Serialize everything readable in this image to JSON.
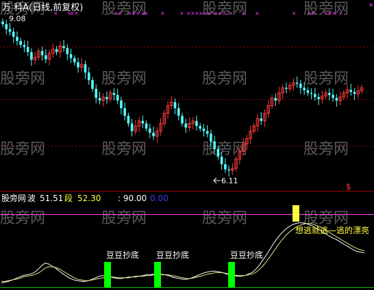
{
  "watermark": "股旁网",
  "upper_panel": {
    "title": "万 科A(日线,前复权)",
    "high_label": "9.08",
    "low_label": "6.11",
    "signal_glyph": "$"
  },
  "lower_panel": {
    "indicator_label": "股旁网",
    "wave_name": "波",
    "wave_value": "51.51",
    "segment_name": "段",
    "segment_value": "52.30",
    "level_value": ": 90.00",
    "base_value": "0.00",
    "buy_label": "豆豆抄底",
    "sell_label": "想逃就逃—逃的漂亮"
  },
  "colors": {
    "background": "#000000",
    "up_candle": "#ff3a3a",
    "down_candle": "#54ffff",
    "grid": "#a00000",
    "magenta": "#ff40ff",
    "yellow": "#ffff40",
    "white": "#ffffff",
    "green": "#00ff00",
    "blue": "#3b3bff",
    "title_color": "#ffffff"
  },
  "chart_data": [
    {
      "type": "candlestick",
      "name": "price",
      "annotations": [
        {
          "text": "9.08",
          "kind": "high"
        },
        {
          "text": "6.11",
          "kind": "low"
        }
      ],
      "ylim": [
        5.9,
        9.2
      ],
      "close": [
        9.05,
        8.95,
        8.9,
        8.8,
        8.72,
        8.64,
        8.6,
        8.5,
        8.35,
        8.4,
        8.52,
        8.44,
        8.36,
        8.48,
        8.56,
        8.5,
        8.62,
        8.58,
        8.46,
        8.38,
        8.3,
        8.2,
        8.26,
        8.1,
        7.95,
        7.78,
        7.6,
        7.55,
        7.62,
        7.58,
        7.7,
        7.66,
        7.55,
        7.4,
        7.25,
        7.1,
        6.95,
        7.05,
        7.15,
        7.1,
        7.0,
        6.92,
        6.85,
        6.95,
        7.1,
        7.3,
        7.45,
        7.52,
        7.4,
        7.25,
        7.1,
        7.02,
        7.1,
        7.15,
        7.05,
        7.0,
        6.95,
        6.9,
        6.75,
        6.6,
        6.45,
        6.3,
        6.2,
        6.18,
        6.22,
        6.4,
        6.55,
        6.7,
        6.8,
        6.95,
        7.05,
        7.2,
        7.15,
        7.3,
        7.45,
        7.6,
        7.55,
        7.7,
        7.8,
        7.78,
        7.85,
        7.9,
        7.88,
        7.8,
        7.75,
        7.7,
        7.68,
        7.62,
        7.58,
        7.64,
        7.7,
        7.66,
        7.6,
        7.55,
        7.62,
        7.7,
        7.76,
        7.72,
        7.68,
        7.74,
        7.8
      ]
    },
    {
      "type": "line",
      "name": "indicator",
      "ylim": [
        0,
        100
      ],
      "reference_levels": [
        90,
        0
      ],
      "series": [
        {
          "color": "white",
          "values": [
            6,
            7,
            8,
            10,
            12,
            14,
            16,
            17,
            18,
            20,
            24,
            29,
            33,
            32,
            29,
            26,
            22,
            18,
            15,
            12,
            10,
            9,
            8,
            8,
            9,
            11,
            13,
            15,
            16,
            15,
            14,
            13,
            12,
            12,
            13,
            14,
            14,
            15,
            15,
            16,
            17,
            17,
            18,
            18,
            18,
            17,
            16,
            14,
            13,
            12,
            11,
            11,
            12,
            14,
            16,
            18,
            20,
            21,
            22,
            22,
            21,
            20,
            18,
            17,
            16,
            15,
            15,
            16,
            18,
            20,
            24,
            30,
            37,
            44,
            52,
            60,
            67,
            73,
            78,
            82,
            85,
            87,
            88,
            88,
            87,
            85,
            83,
            80,
            77,
            74,
            71,
            68,
            66,
            63,
            60,
            57,
            54,
            51,
            49,
            48,
            47
          ]
        },
        {
          "color": "yellow",
          "values": [
            8,
            8,
            9,
            10,
            11,
            12,
            14,
            15,
            16,
            17,
            19,
            22,
            26,
            28,
            28,
            27,
            25,
            22,
            19,
            16,
            13,
            11,
            10,
            9,
            9,
            10,
            11,
            12,
            13,
            14,
            14,
            14,
            13,
            13,
            13,
            13,
            14,
            14,
            15,
            15,
            16,
            16,
            17,
            17,
            17,
            17,
            17,
            16,
            15,
            14,
            13,
            12,
            12,
            13,
            14,
            15,
            17,
            18,
            19,
            20,
            20,
            20,
            19,
            18,
            17,
            16,
            16,
            16,
            17,
            18,
            20,
            24,
            29,
            35,
            42,
            49,
            56,
            63,
            69,
            74,
            78,
            82,
            84,
            86,
            87,
            87,
            86,
            84,
            82,
            79,
            76,
            73,
            70,
            67,
            64,
            61,
            58,
            55,
            53,
            51,
            50
          ]
        }
      ],
      "signals": [
        {
          "kind": "buy",
          "label": "豆豆抄底"
        },
        {
          "kind": "buy",
          "label": "豆豆抄底"
        },
        {
          "kind": "buy",
          "label": "豆豆抄底"
        },
        {
          "kind": "sell",
          "label": "想逃就逃—逃的漂亮"
        }
      ]
    }
  ]
}
